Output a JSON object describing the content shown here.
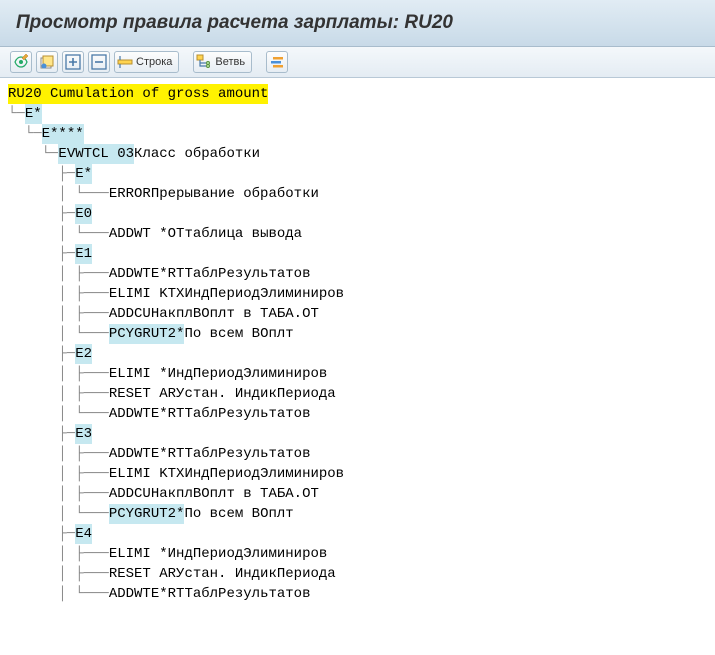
{
  "title": "Просмотр правила расчета зарплаты: RU20",
  "toolbar": {
    "stroka": "Строка",
    "vetv": "Ветвь"
  },
  "rule": {
    "code": "RU20",
    "desc": "Cumulation of gross amount"
  },
  "tree": {
    "e": "E",
    "star": "*",
    "stars4": "****",
    "vwtcl": "VWTCL 03",
    "vwtcl_desc": "Класс обработки",
    "case_star": "*",
    "error": "ERROR",
    "error_desc": "Прерывание обработки",
    "case0": "0",
    "addwt_star": "ADDWT *",
    "ot": "OT",
    "ot_desc": "таблица вывода",
    "case1": "1",
    "addwte_star": "ADDWTE*",
    "rt": "RT",
    "rt_desc": "ТаблРезультатов",
    "elimi_ktx": "ELIMI KTX",
    "elimi_desc": "ИндПериодЭлиминиров",
    "addcu": "ADDCU",
    "addcu_desc": "НакплВОплт в ТАБА.ОТ",
    "pcy": "PCYGRUT2*",
    "pcy_desc": "По всем ВОплт",
    "case2": "2",
    "elimi_star": "ELIMI *",
    "reset_ar": "RESET AR",
    "reset_desc": "Устан. ИндикПериода",
    "case3": "3",
    "case4": "4"
  }
}
